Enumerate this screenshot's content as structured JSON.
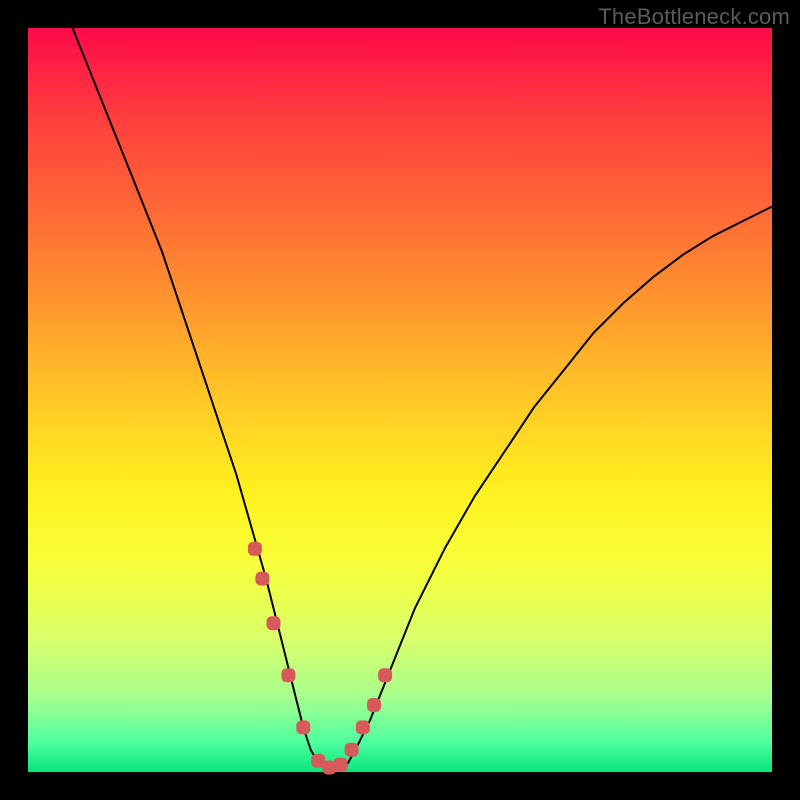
{
  "watermark": "TheBottleneck.com",
  "colors": {
    "background": "#000000",
    "curve": "#000000",
    "marker": "#d65a5a",
    "gradient_stops": [
      "#ff0a4a",
      "#ff3e3e",
      "#ff6a36",
      "#ff9a2e",
      "#ffc826",
      "#fff01f",
      "#f7ff3a",
      "#d9ff6a",
      "#a6ff8f",
      "#4fff9f",
      "#06e57a"
    ]
  },
  "chart_data": {
    "type": "line",
    "title": "",
    "xlabel": "",
    "ylabel": "",
    "xlim": [
      0,
      100
    ],
    "ylim": [
      0,
      100
    ],
    "curve": {
      "x": [
        6,
        8,
        10,
        12,
        14,
        16,
        18,
        20,
        22,
        24,
        26,
        28,
        30,
        32,
        34,
        35,
        36,
        37,
        38,
        39,
        40,
        41,
        42,
        43,
        44,
        46,
        48,
        50,
        52,
        56,
        60,
        64,
        68,
        72,
        76,
        80,
        84,
        88,
        92,
        96,
        100
      ],
      "y": [
        100,
        95,
        90,
        85,
        80,
        75,
        70,
        64,
        58,
        52,
        46,
        40,
        33,
        26,
        18,
        14,
        10,
        6,
        3,
        1.2,
        0.6,
        0.4,
        0.6,
        1.2,
        3,
        7,
        12,
        17,
        22,
        30,
        37,
        43,
        49,
        54,
        59,
        63,
        66.5,
        69.5,
        72,
        74,
        76
      ]
    },
    "markers": {
      "x": [
        30.5,
        31.5,
        33,
        35,
        37,
        39,
        40.5,
        42,
        43.5,
        45,
        46.5,
        48
      ],
      "y": [
        30,
        26,
        20,
        13,
        6,
        1.5,
        0.6,
        1,
        3,
        6,
        9,
        13
      ]
    }
  }
}
